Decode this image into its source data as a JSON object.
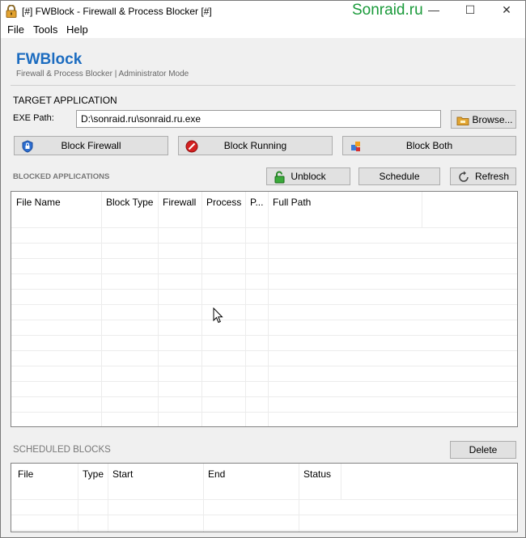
{
  "window": {
    "title": "[#] FWBlock  -  Firewall & Process Blocker [#]",
    "watermark": "Sonraid.ru",
    "minimize": "—",
    "maximize": "☐",
    "close": "✕"
  },
  "menu": {
    "file": "File",
    "tools": "Tools",
    "help": "Help"
  },
  "header": {
    "brand": "FWBlock",
    "subtitle": "Firewall & Process Blocker  |  Administrator Mode"
  },
  "target": {
    "section_title": "TARGET APPLICATION",
    "exe_label": "EXE Path:",
    "exe_value": "D:\\sonraid.ru\\sonraid.ru.exe",
    "browse_label": "Browse..."
  },
  "actions": {
    "block_firewall": "Block Firewall",
    "block_running": "Block Running",
    "block_both": "Block Both"
  },
  "blocked": {
    "section_title": "BLOCKED APPLICATIONS",
    "unblock": "Unblock",
    "schedule": "Schedule",
    "refresh": "Refresh",
    "columns": [
      "File Name",
      "Block Type",
      "Firewall",
      "Process",
      "P...",
      "Full Path"
    ]
  },
  "scheduled": {
    "section_title": "SCHEDULED BLOCKS",
    "delete": "Delete",
    "columns": [
      "File",
      "Type",
      "Start",
      "End",
      "Status"
    ]
  },
  "colors": {
    "brand": "#1c6cc0",
    "watermark": "#1a9a3a",
    "window_bg": "#f0f0f0",
    "button_bg": "#e1e1e1"
  }
}
